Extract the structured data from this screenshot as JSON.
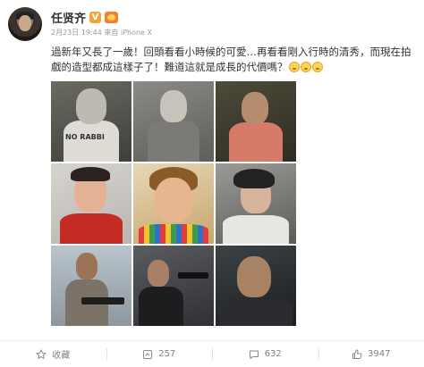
{
  "post": {
    "author": "任贤齐",
    "badge": "V",
    "meta": "2月23日 19:44 来自 iPhone X",
    "text": "過新年又長了一歲！回頭看看小時候的可愛…再看看剛入行時的清秀，而現在拍戲的造型都成這樣子了！難道這就是成長的代價嗎？",
    "photo_caption_1": "NO RABBI"
  },
  "toolbar": {
    "favorite_label": "收藏",
    "repost_count": "257",
    "comment_count": "632",
    "like_count": "3947"
  },
  "icons": {
    "favorite": "star-icon",
    "repost": "repost-icon",
    "comment": "comment-icon",
    "like": "thumbs-up-icon"
  },
  "colors": {
    "vip_badge": "#f2a53a",
    "meta_text": "#999999",
    "toolbar_text": "#808080"
  }
}
